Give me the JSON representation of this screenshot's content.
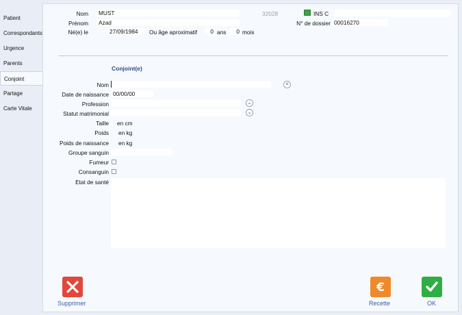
{
  "sidebar": {
    "items": [
      {
        "label": "Patient"
      },
      {
        "label": "Correspondants"
      },
      {
        "label": "Urgence"
      },
      {
        "label": "Parents"
      },
      {
        "label": "Conjoint"
      },
      {
        "label": "Partage"
      },
      {
        "label": "Carte Vitale"
      }
    ],
    "active_index": 4
  },
  "header": {
    "nom_label": "Nom",
    "nom_value": "MUST",
    "patient_id": "32028",
    "ins_label": "INS C",
    "ins_value": "",
    "prenom_label": "Prénom",
    "prenom_value": "Azad",
    "dossier_label": "N° de dossier",
    "dossier_value": "00016270",
    "ne_label": "Né(e) le",
    "ne_value": "27/09/1984",
    "age_label": "Ou âge aproximatif",
    "age_ans_value": "0",
    "age_ans_label": "ans",
    "age_mois_value": "0",
    "age_mois_label": "mois"
  },
  "conjoint": {
    "title": "Conjoint(e)",
    "nom_label": "Nom",
    "nom_value": "",
    "back_button": "<",
    "naissance_label": "Date de naissance",
    "naissance_value": "00/00/00",
    "profession_label": "Profession",
    "profession_value": "",
    "statut_label": "Statut matrimonial",
    "statut_value": "",
    "taille_label": "Taille",
    "taille_unit": "en cm",
    "poids_label": "Poids",
    "poids_unit": "en kg",
    "poids_naissance_label": "Poids de naissance",
    "poids_naissance_unit": "en kg",
    "groupe_label": "Groupe sanguin",
    "groupe_value": "",
    "fumeur_label": "Fumeur",
    "fumeur_checked": false,
    "consanguin_label": "Consanguin",
    "consanguin_checked": false,
    "etat_label": "Etat de santé",
    "etat_value": ""
  },
  "actions": {
    "supprimer_label": "Supprimer",
    "recette_label": "Recette",
    "ok_label": "OK"
  },
  "colors": {
    "accent": "#3a5fa8",
    "delete": "#e2473a",
    "recette": "#ef8a2b",
    "ok": "#2fae45"
  }
}
